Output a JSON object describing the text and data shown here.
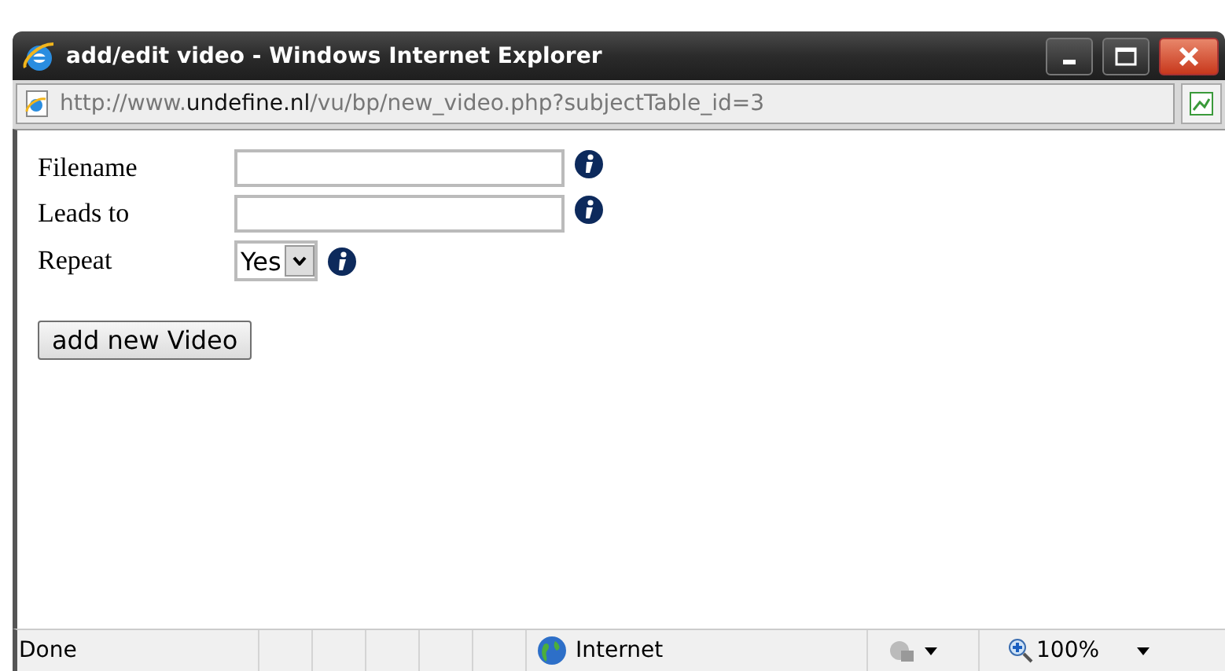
{
  "window": {
    "title": "add/edit video - Windows Internet Explorer"
  },
  "address_bar": {
    "url": "http://www.**undefine.nl**/vu/bp/new_video.php?subjectTable_id=3"
  },
  "form": {
    "fields": [
      {
        "kind": "text",
        "label": "Filename"
      },
      {
        "kind": "text",
        "label": "Leads to"
      },
      {
        "kind": "select",
        "label": "Repeat",
        "value": "Yes"
      }
    ],
    "submit": "add new Video"
  },
  "status_bar": {
    "text": "Done",
    "zone": "Internet",
    "zoom": "100%"
  }
}
